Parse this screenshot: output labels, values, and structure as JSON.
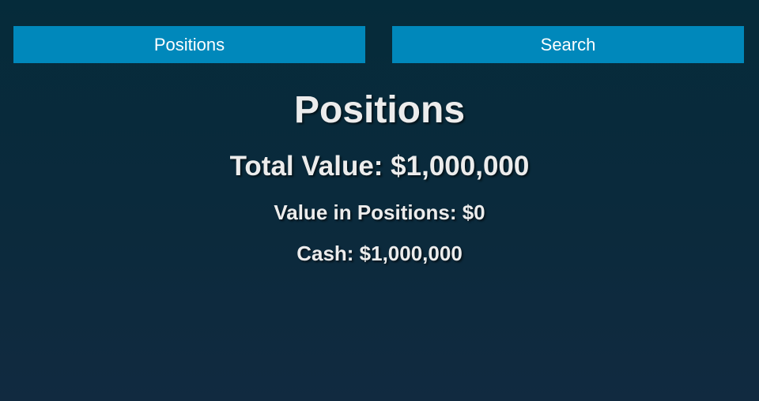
{
  "nav": {
    "positions_label": "Positions",
    "search_label": "Search"
  },
  "colors": {
    "nav_button": "#0088bb",
    "background_top": "#052b3a",
    "background_bottom": "#112a40",
    "text": "#ececec"
  },
  "page": {
    "title": "Positions",
    "total_value": "Total Value: $1,000,000",
    "value_in_positions": "Value in Positions: $0",
    "cash": "Cash: $1,000,000"
  }
}
